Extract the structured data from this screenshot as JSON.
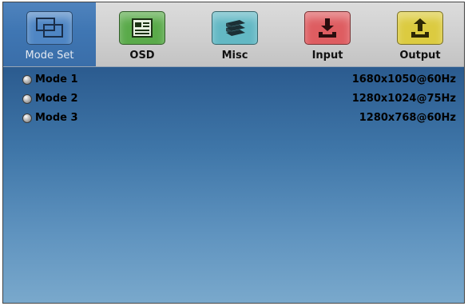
{
  "tabs": [
    {
      "label": "Mode Set",
      "icon": "mode-set-icon",
      "color": "#4f86c4",
      "active": true
    },
    {
      "label": "OSD",
      "icon": "osd-icon",
      "color": "#59a84a",
      "active": false
    },
    {
      "label": "Misc",
      "icon": "misc-icon",
      "color": "#5fb5c2",
      "active": false
    },
    {
      "label": "Input",
      "icon": "input-icon",
      "color": "#dc5a5e",
      "active": false
    },
    {
      "label": "Output",
      "icon": "output-icon",
      "color": "#d9c83d",
      "active": false
    }
  ],
  "modes": [
    {
      "name": "Mode 1",
      "resolution": "1680x1050@60Hz"
    },
    {
      "name": "Mode 2",
      "resolution": "1280x1024@75Hz"
    },
    {
      "name": "Mode 3",
      "resolution": "1280x768@60Hz"
    }
  ]
}
